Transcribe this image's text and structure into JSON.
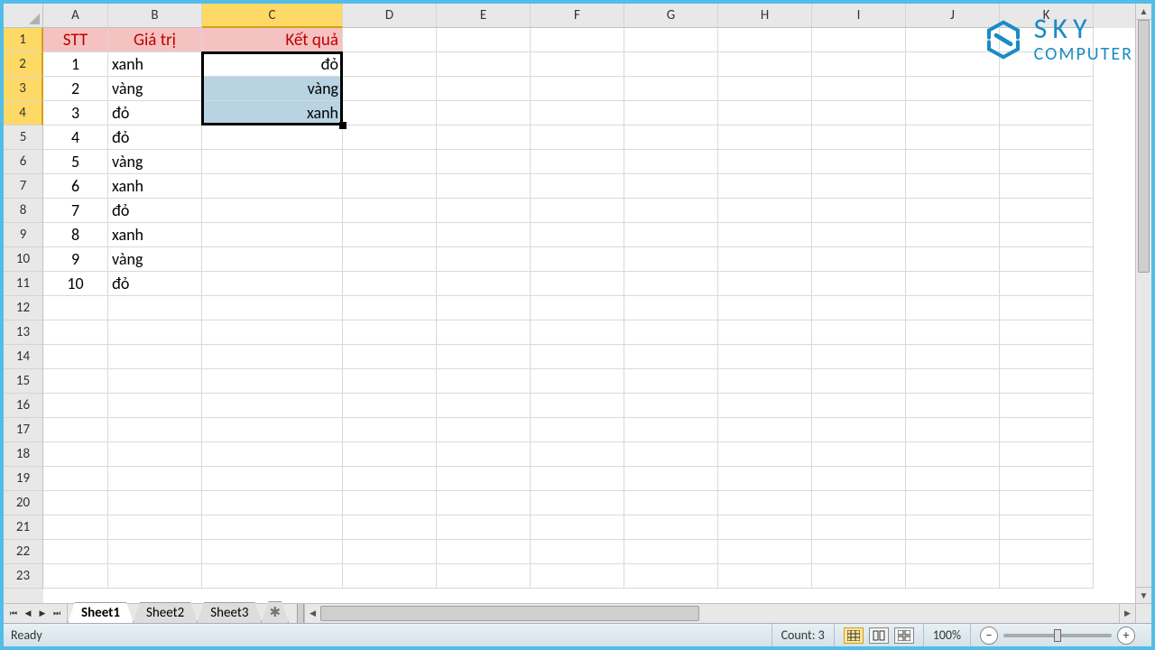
{
  "columns": [
    "A",
    "B",
    "C",
    "D",
    "E",
    "F",
    "G",
    "H",
    "I",
    "J",
    "K"
  ],
  "rowCount": 23,
  "headerRow": {
    "A": "STT",
    "B": "Giá trị",
    "C": "Kết quả"
  },
  "data": [
    {
      "A": "1",
      "B": "xanh",
      "C": "đỏ"
    },
    {
      "A": "2",
      "B": "vàng",
      "C": "vàng"
    },
    {
      "A": "3",
      "B": "đỏ",
      "C": "xanh"
    },
    {
      "A": "4",
      "B": "đỏ",
      "C": ""
    },
    {
      "A": "5",
      "B": "vàng",
      "C": ""
    },
    {
      "A": "6",
      "B": "xanh",
      "C": ""
    },
    {
      "A": "7",
      "B": "đỏ",
      "C": ""
    },
    {
      "A": "8",
      "B": "xanh",
      "C": ""
    },
    {
      "A": "9",
      "B": "vàng",
      "C": ""
    },
    {
      "A": "10",
      "B": "đỏ",
      "C": ""
    }
  ],
  "highlight": {
    "col": "C",
    "rows": [
      1,
      2,
      3,
      4
    ]
  },
  "selection": {
    "col": "C",
    "startRow": 2,
    "endRow": 4
  },
  "tabs": {
    "items": [
      "Sheet1",
      "Sheet2",
      "Sheet3"
    ],
    "active": 0
  },
  "status": {
    "ready": "Ready",
    "count_label": "Count: 3",
    "zoom": "100%"
  },
  "logo": {
    "line1": "SKY",
    "line2": "COMPUTER"
  },
  "colors": {
    "frame": "#52bde8",
    "header_fill": "#f5c2c2",
    "header_text": "#c00000",
    "row_col_hl": "#ffd966",
    "sel_fill": "#b8d4e3"
  }
}
